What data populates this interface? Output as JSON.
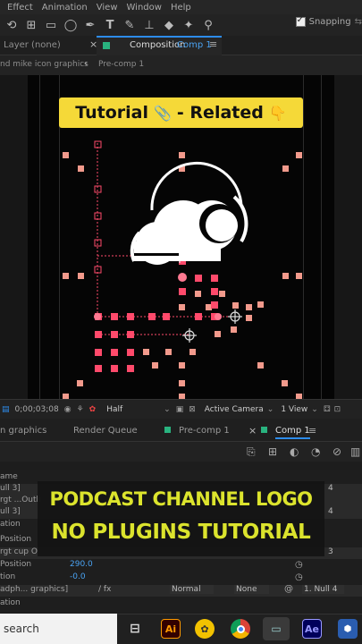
{
  "menu": [
    "Effect",
    "Animation",
    "View",
    "Window",
    "Help"
  ],
  "toolbar": {
    "snapping_label": "Snapping"
  },
  "panels": {
    "layer_tab": "Layer  (none)",
    "comp_tab_prefix": "Composition",
    "comp_tab_name": "Comp 1",
    "breadcrumb_1": "nd mike icon graphics",
    "breadcrumb_2": "Pre-comp 1"
  },
  "banner": {
    "left": "Tutorial",
    "right": "- Related"
  },
  "viewer_controls": {
    "timecode": "0;00;03;08",
    "resolution": "Half",
    "camera": "Active Camera",
    "views": "1 View"
  },
  "timeline_tabs": {
    "t1": "n graphics",
    "t2": "Render Queue",
    "t3": "Pre-comp 1",
    "t4": "Comp 1"
  },
  "layers": [
    {
      "name": "ame",
      "val": ""
    },
    {
      "name": "ull 3]",
      "val": "4"
    },
    {
      "name": "rgt ...Outli",
      "val": "4"
    },
    {
      "name": "ull 3]",
      "val": "4"
    },
    {
      "name": "ation",
      "val": ""
    },
    {
      "name": "Position",
      "val": ""
    },
    {
      "name": "rgt cup O",
      "val": "3"
    },
    {
      "name": "Position",
      "val": "290.0"
    },
    {
      "name": "tion",
      "val": "-0.0"
    },
    {
      "name": "adph... graphics]",
      "val": ""
    },
    {
      "name": "ation",
      "val": ""
    }
  ],
  "row_controls": {
    "mode1": "Normal",
    "mode2": "None",
    "parent": "1. Null 4",
    "fx": "/ fx"
  },
  "overlay": {
    "line1": "PODCAST CHANNEL  LOGO",
    "line2": "NO PLUGINS TUTORIAL"
  },
  "taskbar": {
    "search": "search",
    "ai_label": "Ai",
    "ae_label": "Ae"
  },
  "colors": {
    "banner": "#f5d938",
    "overlay_text": "#e6ee2e",
    "keyframe_pink": "#ff4a6b",
    "accent_blue": "#2d8ceb"
  }
}
